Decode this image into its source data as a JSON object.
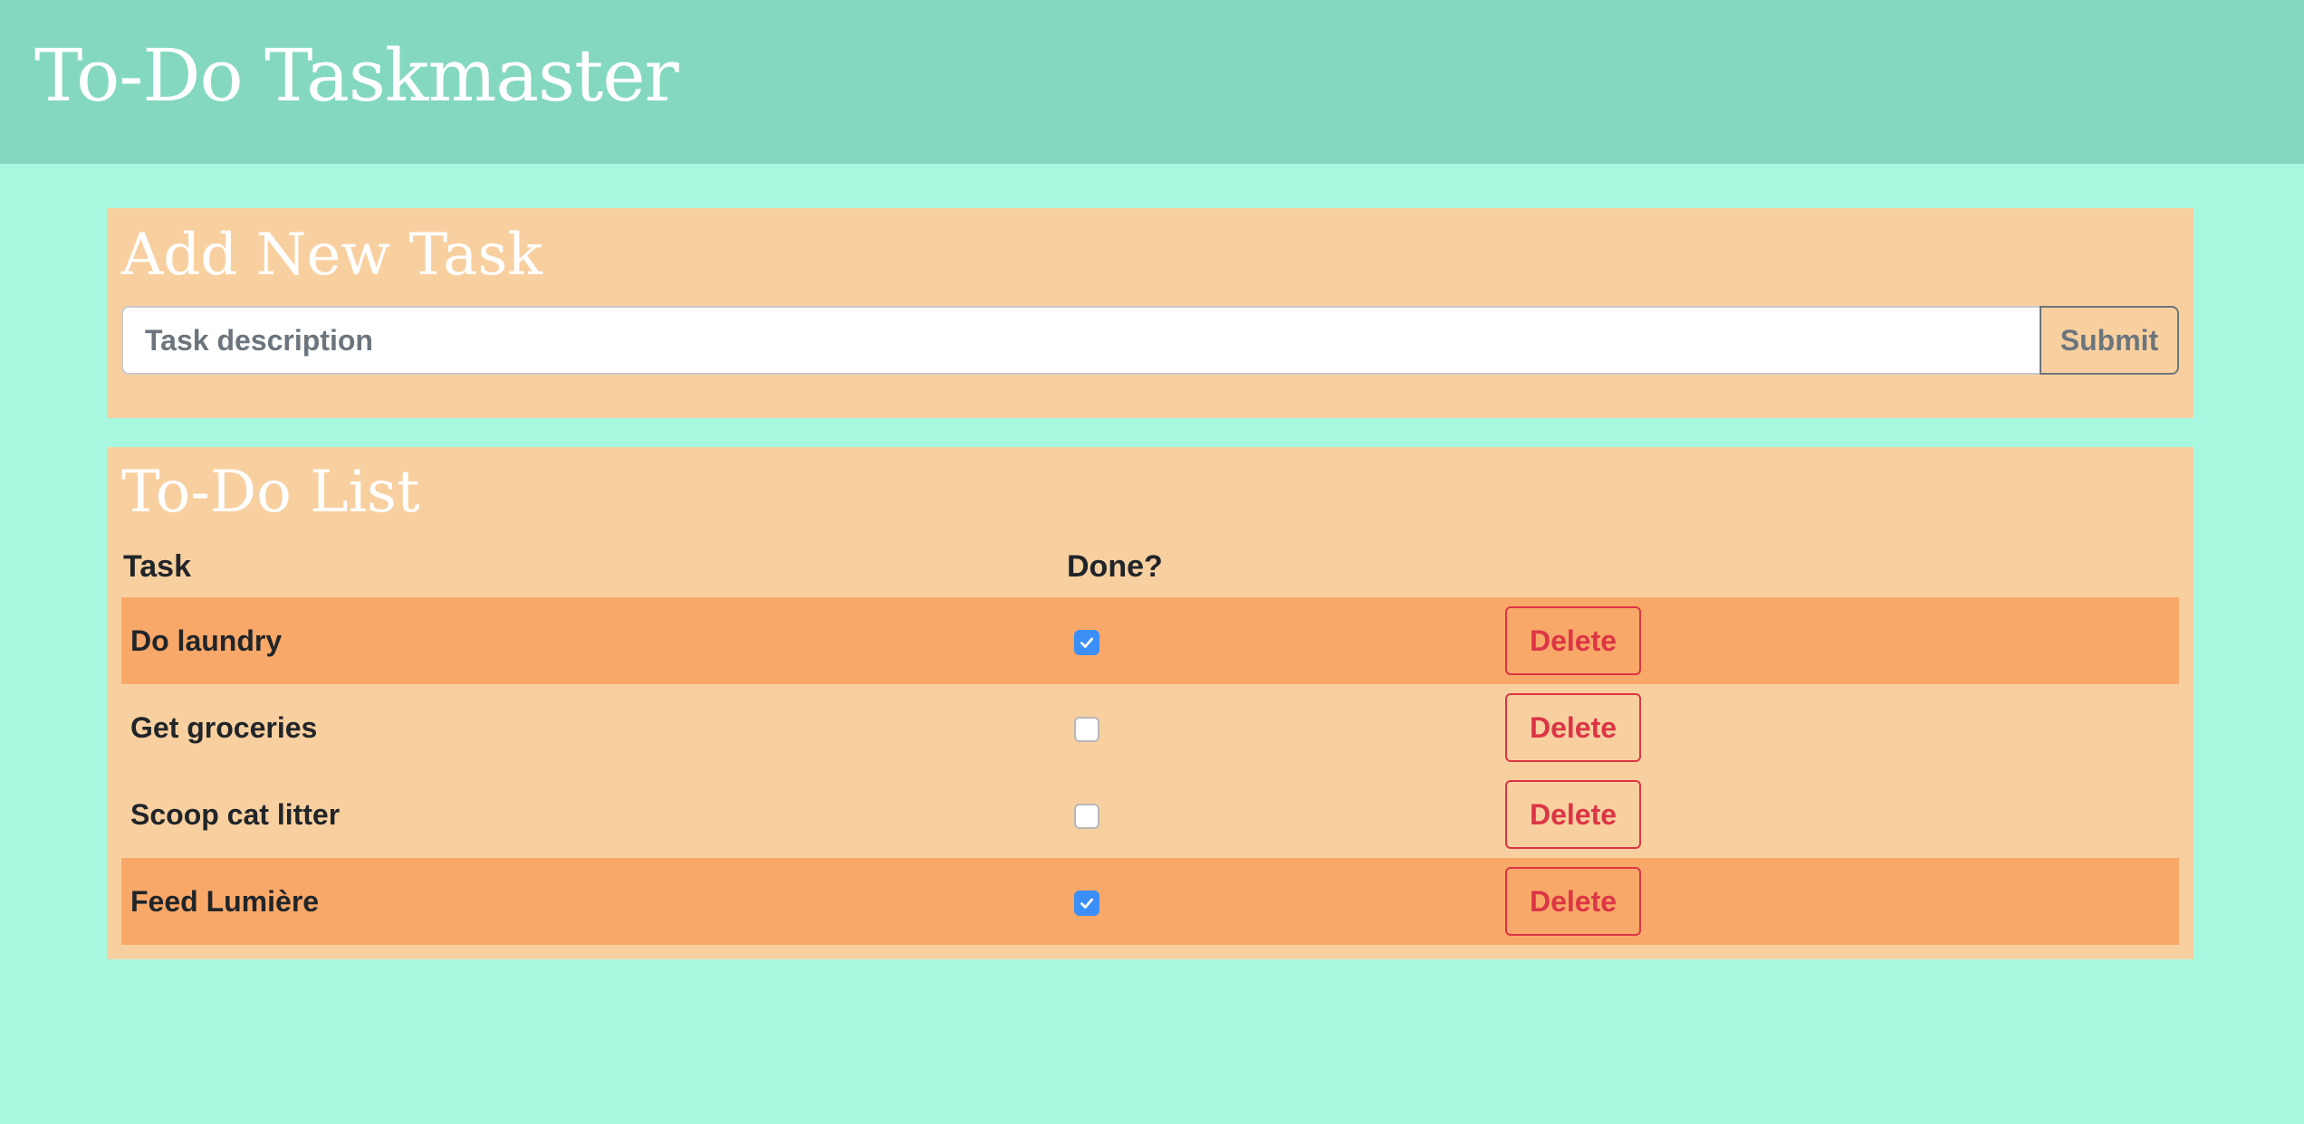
{
  "header": {
    "title": "To-Do Taskmaster"
  },
  "add_task": {
    "title": "Add New Task",
    "input_placeholder": "Task description",
    "input_value": "",
    "submit_label": "Submit"
  },
  "todo_list": {
    "title": "To-Do List",
    "columns": {
      "task": "Task",
      "done": "Done?"
    },
    "delete_label": "Delete",
    "rows": [
      {
        "task": "Do laundry",
        "done": true
      },
      {
        "task": "Get groceries",
        "done": false
      },
      {
        "task": "Scoop cat litter",
        "done": false
      },
      {
        "task": "Feed Lumière",
        "done": true
      }
    ]
  },
  "colors": {
    "page_background": "#a8f8e0",
    "header_background": "#84d8c0",
    "panel_background": "#f8d0a0",
    "done_row_background": "#f8a868",
    "delete_red": "#dc3545",
    "checkbox_blue": "#3b8ff6"
  }
}
